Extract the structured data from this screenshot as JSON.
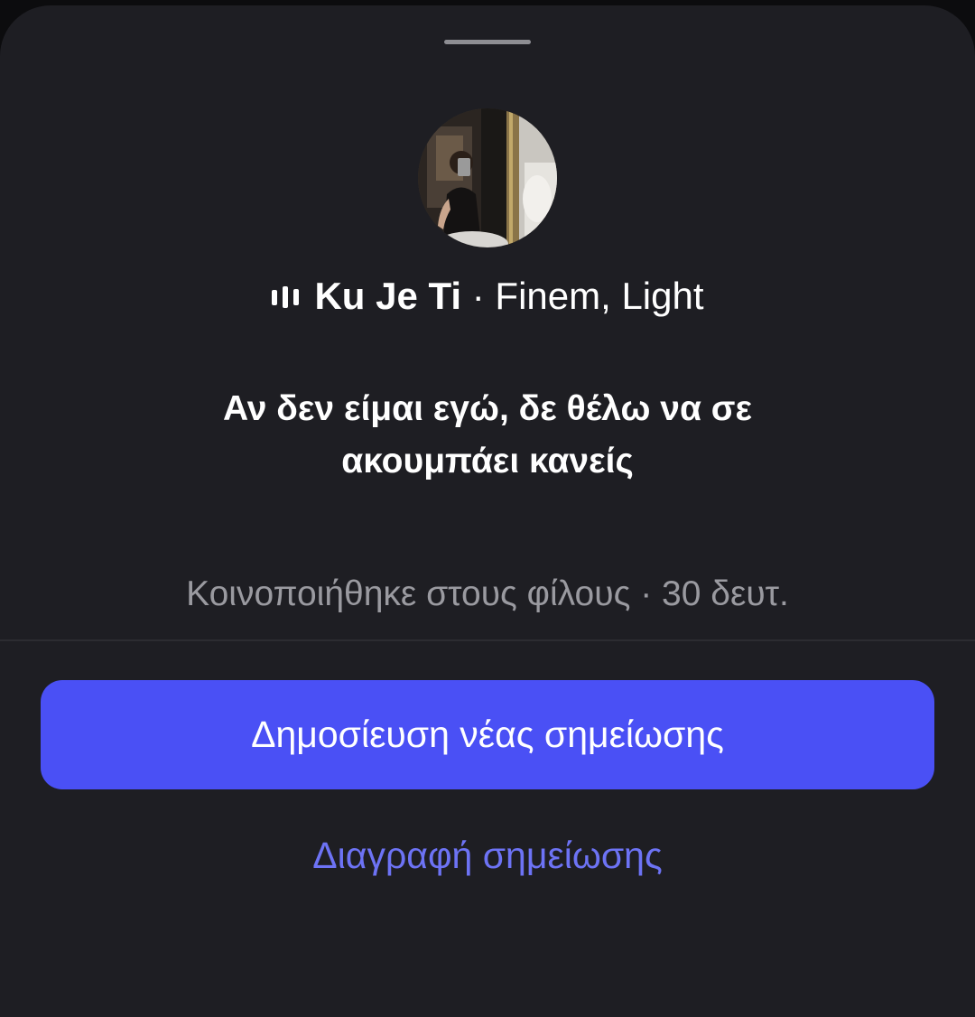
{
  "sheet": {
    "song": {
      "icon": "audio-bars-icon",
      "title": "Ku Je Ti",
      "separator": "·",
      "artist": "Finem, Light"
    },
    "note_text": "Αν δεν είμαι εγώ, δε θέλω να σε ακουμπάει κανείς",
    "shared_info": "Κοινοποιήθηκε στους φίλους · 30 δευτ.",
    "primary_button_label": "Δημοσίευση νέας σημείωσης",
    "delete_link_label": "Διαγραφή σημείωσης",
    "colors": {
      "sheet_background": "#1e1e23",
      "primary_button": "#4a50f5",
      "link": "#6d73f5",
      "secondary_text": "#9a9aa0"
    }
  }
}
